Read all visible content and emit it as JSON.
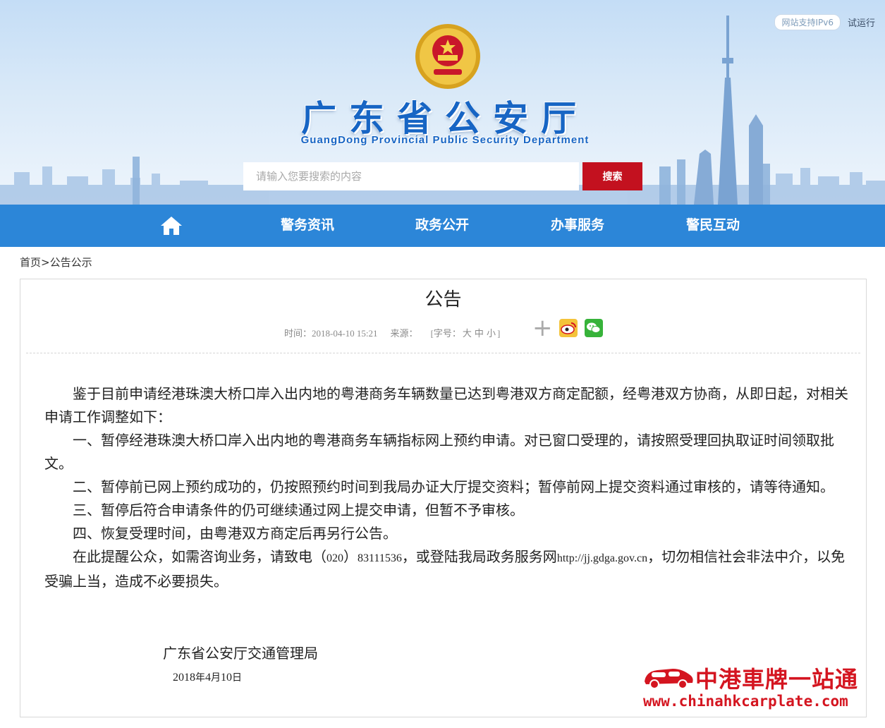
{
  "header": {
    "ipv6_badge": "网站支持IPv6",
    "trial": "试运行",
    "title": "广东省公安厅",
    "subtitle": "GuangDong Provincial Public Security Department",
    "search_placeholder": "请输入您要搜索的内容",
    "search_button": "搜索"
  },
  "nav": {
    "home_icon": "home-icon",
    "items": [
      {
        "label": "警务资讯"
      },
      {
        "label": "政务公开"
      },
      {
        "label": "办事服务"
      },
      {
        "label": "警民互动"
      }
    ]
  },
  "breadcrumb": {
    "home": "首页",
    "separator": ">",
    "current": "公告公示"
  },
  "article": {
    "title": "公告",
    "time_label": "时间：",
    "time_value": "2018-04-10 15:21",
    "source_label": "来源：",
    "font_size_open": "[字号：",
    "font_large": "大",
    "font_medium": "中",
    "font_small": "小",
    "font_size_close": "]",
    "share_icons": [
      "plus-icon",
      "weibo-icon",
      "wechat-icon"
    ],
    "paragraphs": {
      "p1": "鉴于目前申请经港珠澳大桥口岸入出内地的粤港商务车辆数量已达到粤港双方商定配额，经粤港双方协商，从即日起，对相关申请工作调整如下：",
      "p2": "一、暂停经港珠澳大桥口岸入出内地的粤港商务车辆指标网上预约申请。对已窗口受理的，请按照受理回执取证时间领取批文。",
      "p3": "二、暂停前已网上预约成功的，仍按照预约时间到我局办证大厅提交资料；暂停前网上提交资料通过审核的，请等待通知。",
      "p4": "三、暂停后符合申请条件的仍可继续通过网上提交申请，但暂不予审核。",
      "p5": "四、恢复受理时间，由粤港双方商定后再另行公告。",
      "p6_a": "在此提醒公众，如需咨询业务，请致电（",
      "p6_area": "020",
      "p6_b": "）",
      "p6_phone": "83111536",
      "p6_c": "，或登陆我局政务服务网",
      "p6_url": "http://jj.gdga.gov.cn",
      "p6_d": "，切勿相信社会非法中介，以免受骗上当，造成不必要损失。"
    },
    "signature": "广东省公安厅交通管理局",
    "sign_date_year": "2018",
    "sign_date_year_unit": "年",
    "sign_date_month": "4",
    "sign_date_month_unit": "月",
    "sign_date_day": "10",
    "sign_date_day_unit": "日"
  },
  "watermark": {
    "text": "中港車牌一站通",
    "url": "www.chinahkcarplate.com"
  },
  "colors": {
    "nav_blue": "#2c86d8",
    "title_blue": "#1765c4",
    "search_red": "#c3111f",
    "watermark_red": "#d41520"
  }
}
